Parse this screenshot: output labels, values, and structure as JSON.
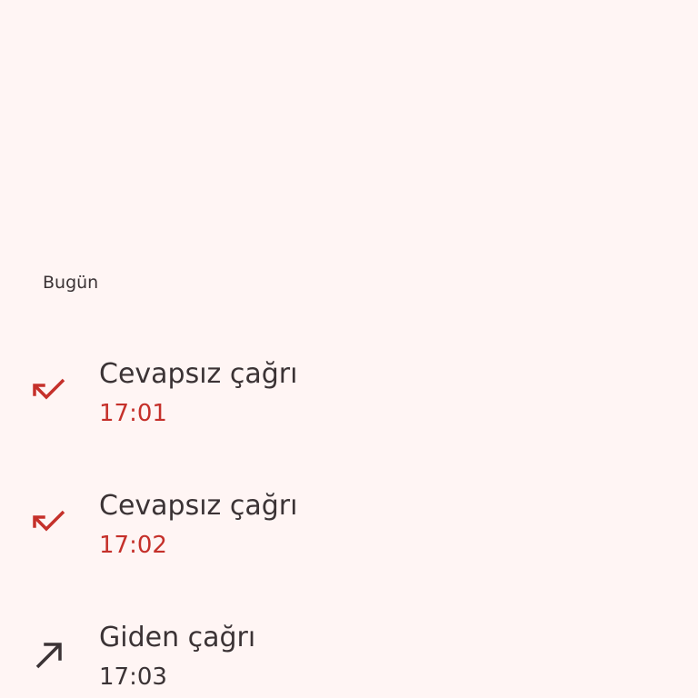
{
  "section": {
    "label": "Bugün"
  },
  "colors": {
    "background": "#fff5f4",
    "missed": "#c5302a",
    "text": "#3b3335"
  },
  "calls": [
    {
      "type": "missed",
      "icon": "missed-call-icon",
      "title": "Cevapsız çağrı",
      "time": "17:01"
    },
    {
      "type": "missed",
      "icon": "missed-call-icon",
      "title": "Cevapsız çağrı",
      "time": "17:02"
    },
    {
      "type": "outgoing",
      "icon": "outgoing-call-icon",
      "title": "Giden çağrı",
      "time": "17:03"
    }
  ]
}
